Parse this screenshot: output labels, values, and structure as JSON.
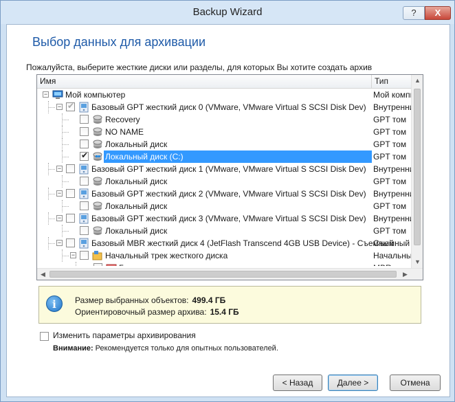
{
  "window": {
    "title": "Backup Wizard",
    "help_label": "?",
    "close_label": "X"
  },
  "page": {
    "heading": "Выбор данных для архивации",
    "instruction": "Пожалуйста, выберите жесткие диски или разделы, для которых Вы хотите создать архив"
  },
  "tree": {
    "columns": {
      "name": "Имя",
      "type": "Тип"
    },
    "rows": [
      {
        "label": "Мой компьютер",
        "type": "Мой компьютер",
        "icon": "computer-icon",
        "checked": false
      },
      {
        "label": "Базовый GPT жесткий диск 0 (VMware, VMware Virtual S SCSI Disk Dev)",
        "type": "Внутренний",
        "icon": "disk-icon",
        "checked": true
      },
      {
        "label": "Recovery",
        "type": "GPT том",
        "icon": "volume-icon",
        "checked": false
      },
      {
        "label": "NO NAME",
        "type": "GPT том",
        "icon": "volume-icon",
        "checked": false
      },
      {
        "label": "Локальный диск",
        "type": "GPT том",
        "icon": "volume-icon",
        "checked": false
      },
      {
        "label": "Локальный диск (C:)",
        "type": "GPT том",
        "icon": "windows-volume-icon",
        "checked": true
      },
      {
        "label": "Базовый GPT жесткий диск 1 (VMware, VMware Virtual S SCSI Disk Dev)",
        "type": "Внутренний",
        "icon": "disk-icon",
        "checked": false
      },
      {
        "label": "Локальный диск",
        "type": "GPT том",
        "icon": "volume-icon",
        "checked": false
      },
      {
        "label": "Базовый GPT жесткий диск 2 (VMware, VMware Virtual S SCSI Disk Dev)",
        "type": "Внутренний",
        "icon": "disk-icon",
        "checked": false
      },
      {
        "label": "Локальный диск",
        "type": "GPT том",
        "icon": "volume-icon",
        "checked": false
      },
      {
        "label": "Базовый GPT жесткий диск 3 (VMware, VMware Virtual S SCSI Disk Dev)",
        "type": "Внутренний",
        "icon": "disk-icon",
        "checked": false
      },
      {
        "label": "Локальный диск",
        "type": "GPT том",
        "icon": "volume-icon",
        "checked": false
      },
      {
        "label": "Базовый MBR жесткий диск 4 (JetFlash Transcend 4GB USB Device) - Съемный",
        "type": "Съемный",
        "icon": "disk-icon",
        "checked": false
      },
      {
        "label": "Начальный трек жесткого диска",
        "type": "Начальный",
        "icon": "track-icon",
        "checked": false
      },
      {
        "label": "Главная загрузочная запись",
        "type": "MBR",
        "icon": "mbr-icon",
        "checked": false
      }
    ]
  },
  "info": {
    "selected_label": "Размер выбранных объектов:",
    "selected_value": "499.4 ГБ",
    "archive_label": "Ориентировочный размер архива:",
    "archive_value": "15.4 ГБ"
  },
  "options": {
    "change_params_label": "Изменить параметры архивирования",
    "change_params_checked": false,
    "warning_bold": "Внимание:",
    "warning_text": "Рекомендуется только для опытных пользователей."
  },
  "buttons": {
    "back": "< Назад",
    "next": "Далее >",
    "cancel": "Отмена"
  },
  "colors": {
    "heading": "#1e5aa8",
    "selection": "#3399ff",
    "info_bg": "#fcfbdd"
  }
}
